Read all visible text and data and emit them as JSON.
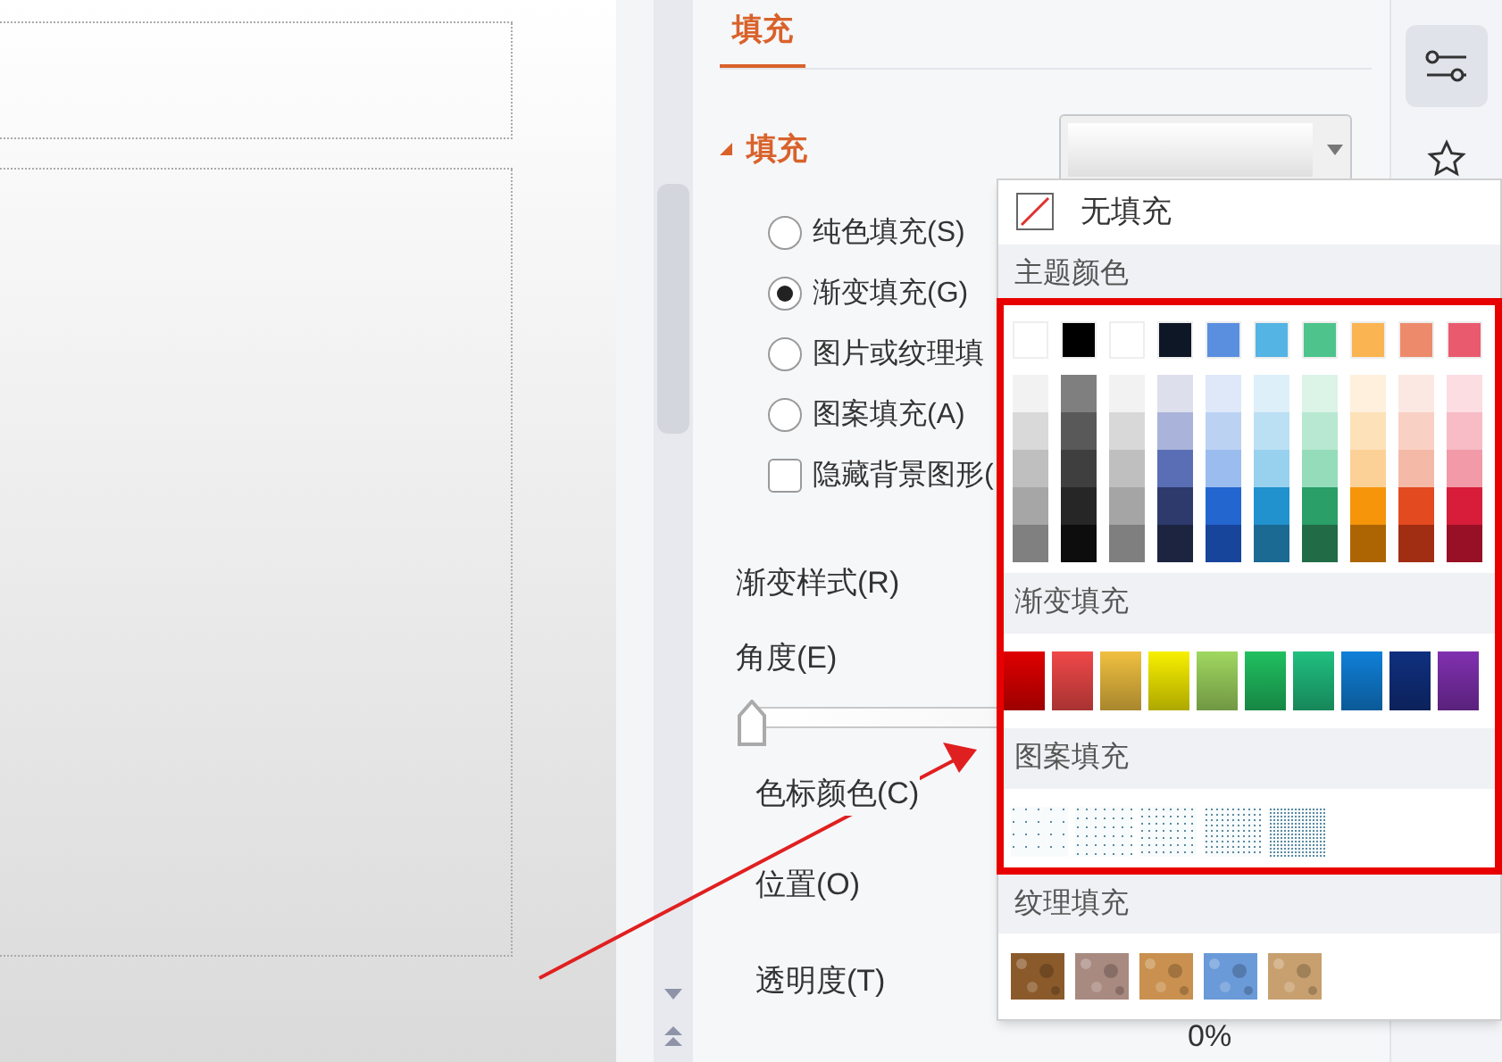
{
  "tab": {
    "label": "填充",
    "selected": true
  },
  "section": {
    "title": "填充",
    "expanded": true
  },
  "fill_options": [
    {
      "kind": "radio",
      "label": "纯色填充(S)",
      "selected": false
    },
    {
      "kind": "radio",
      "label": "渐变填充(G)",
      "selected": true
    },
    {
      "kind": "radio",
      "label": "图片或纹理填",
      "selected": false
    },
    {
      "kind": "radio",
      "label": "图案填充(A)",
      "selected": false
    },
    {
      "kind": "checkbox",
      "label": "隐藏背景图形(",
      "checked": false
    }
  ],
  "gradient_style_label": "渐变样式(R)",
  "angle": {
    "label": "角度(E)",
    "level": 0
  },
  "stop_color_label": "色标颜色(C)",
  "position_label": "位置(O)",
  "transparency": {
    "label": "透明度(T)",
    "value": "0%"
  },
  "popup": {
    "no_fill": "无填充",
    "theme_title": "主题颜色",
    "theme_colors": [
      {
        "color": "#ffffff",
        "shades": [
          {
            "color": "#f2f2f2"
          },
          {
            "color": "#d9d9d9"
          },
          {
            "color": "#bfbfbf"
          },
          {
            "color": "#a6a6a6"
          },
          {
            "color": "#808080"
          }
        ]
      },
      {
        "color": "#000000",
        "shades": [
          {
            "color": "#7f7f7f"
          },
          {
            "color": "#595959"
          },
          {
            "color": "#3f3f3f"
          },
          {
            "color": "#262626"
          },
          {
            "color": "#0d0d0d"
          }
        ]
      },
      {
        "color": "#ffffff",
        "shades": [
          {
            "color": "#f2f2f2"
          },
          {
            "color": "#d8d8d8"
          },
          {
            "color": "#bfbfbf"
          },
          {
            "color": "#a5a5a5"
          },
          {
            "color": "#7f7f7f"
          }
        ]
      },
      {
        "color": "#0e1726",
        "shades": [
          {
            "color": "#dde0ec"
          },
          {
            "color": "#aab3d9"
          },
          {
            "color": "#5a6eb5"
          },
          {
            "color": "#2d3a6b"
          },
          {
            "color": "#1c2440"
          }
        ]
      },
      {
        "color": "#5a8fe0",
        "shades": [
          {
            "color": "#dee8f9"
          },
          {
            "color": "#bcd2f3"
          },
          {
            "color": "#9bbcee"
          },
          {
            "color": "#2466d0"
          },
          {
            "color": "#17459c"
          }
        ]
      },
      {
        "color": "#54b4e4",
        "shades": [
          {
            "color": "#ddeff9"
          },
          {
            "color": "#bbe0f4"
          },
          {
            "color": "#98d1ee"
          },
          {
            "color": "#2192cd"
          },
          {
            "color": "#1b6a94"
          }
        ]
      },
      {
        "color": "#4ec48c",
        "shades": [
          {
            "color": "#dcf3e8"
          },
          {
            "color": "#b8e8d1"
          },
          {
            "color": "#95dcba"
          },
          {
            "color": "#2a9f68"
          },
          {
            "color": "#226b47"
          }
        ]
      },
      {
        "color": "#fbb452",
        "shades": [
          {
            "color": "#fef0dc"
          },
          {
            "color": "#fde1b9"
          },
          {
            "color": "#fcd197"
          },
          {
            "color": "#f6950a"
          },
          {
            "color": "#ad6504"
          }
        ]
      },
      {
        "color": "#ee8a6c",
        "shades": [
          {
            "color": "#fce8e2"
          },
          {
            "color": "#f9d0c4"
          },
          {
            "color": "#f5b9a7"
          },
          {
            "color": "#e34a1f"
          },
          {
            "color": "#a12e12"
          }
        ]
      },
      {
        "color": "#e95a6e",
        "shades": [
          {
            "color": "#fbdde2"
          },
          {
            "color": "#f7bcc5"
          },
          {
            "color": "#f39aa8"
          },
          {
            "color": "#d81d3a"
          },
          {
            "color": "#981025"
          }
        ]
      }
    ],
    "gradient_title": "渐变填充",
    "gradients": [
      {
        "color": "#e00000"
      },
      {
        "color": "#f04848"
      },
      {
        "color": "#f0c040"
      },
      {
        "color": "#f8f000"
      },
      {
        "color": "#a0d860"
      },
      {
        "color": "#20c060"
      },
      {
        "color": "#20c080"
      },
      {
        "color": "#1080d8"
      },
      {
        "color": "#103080"
      },
      {
        "color": "#8030b0"
      }
    ],
    "pattern_title": "图案填充",
    "patterns": [
      {
        "kind": "sparse"
      },
      {
        "kind": "light"
      },
      {
        "kind": "medium"
      },
      {
        "kind": "dense"
      },
      {
        "kind": "heavy"
      }
    ],
    "texture_title": "纹理填充",
    "textures": [
      {
        "color": "#8b5a2b"
      },
      {
        "color": "#a88a80"
      },
      {
        "color": "#c9904f"
      },
      {
        "color": "#6a9ad8"
      },
      {
        "color": "#c8a070"
      }
    ]
  }
}
